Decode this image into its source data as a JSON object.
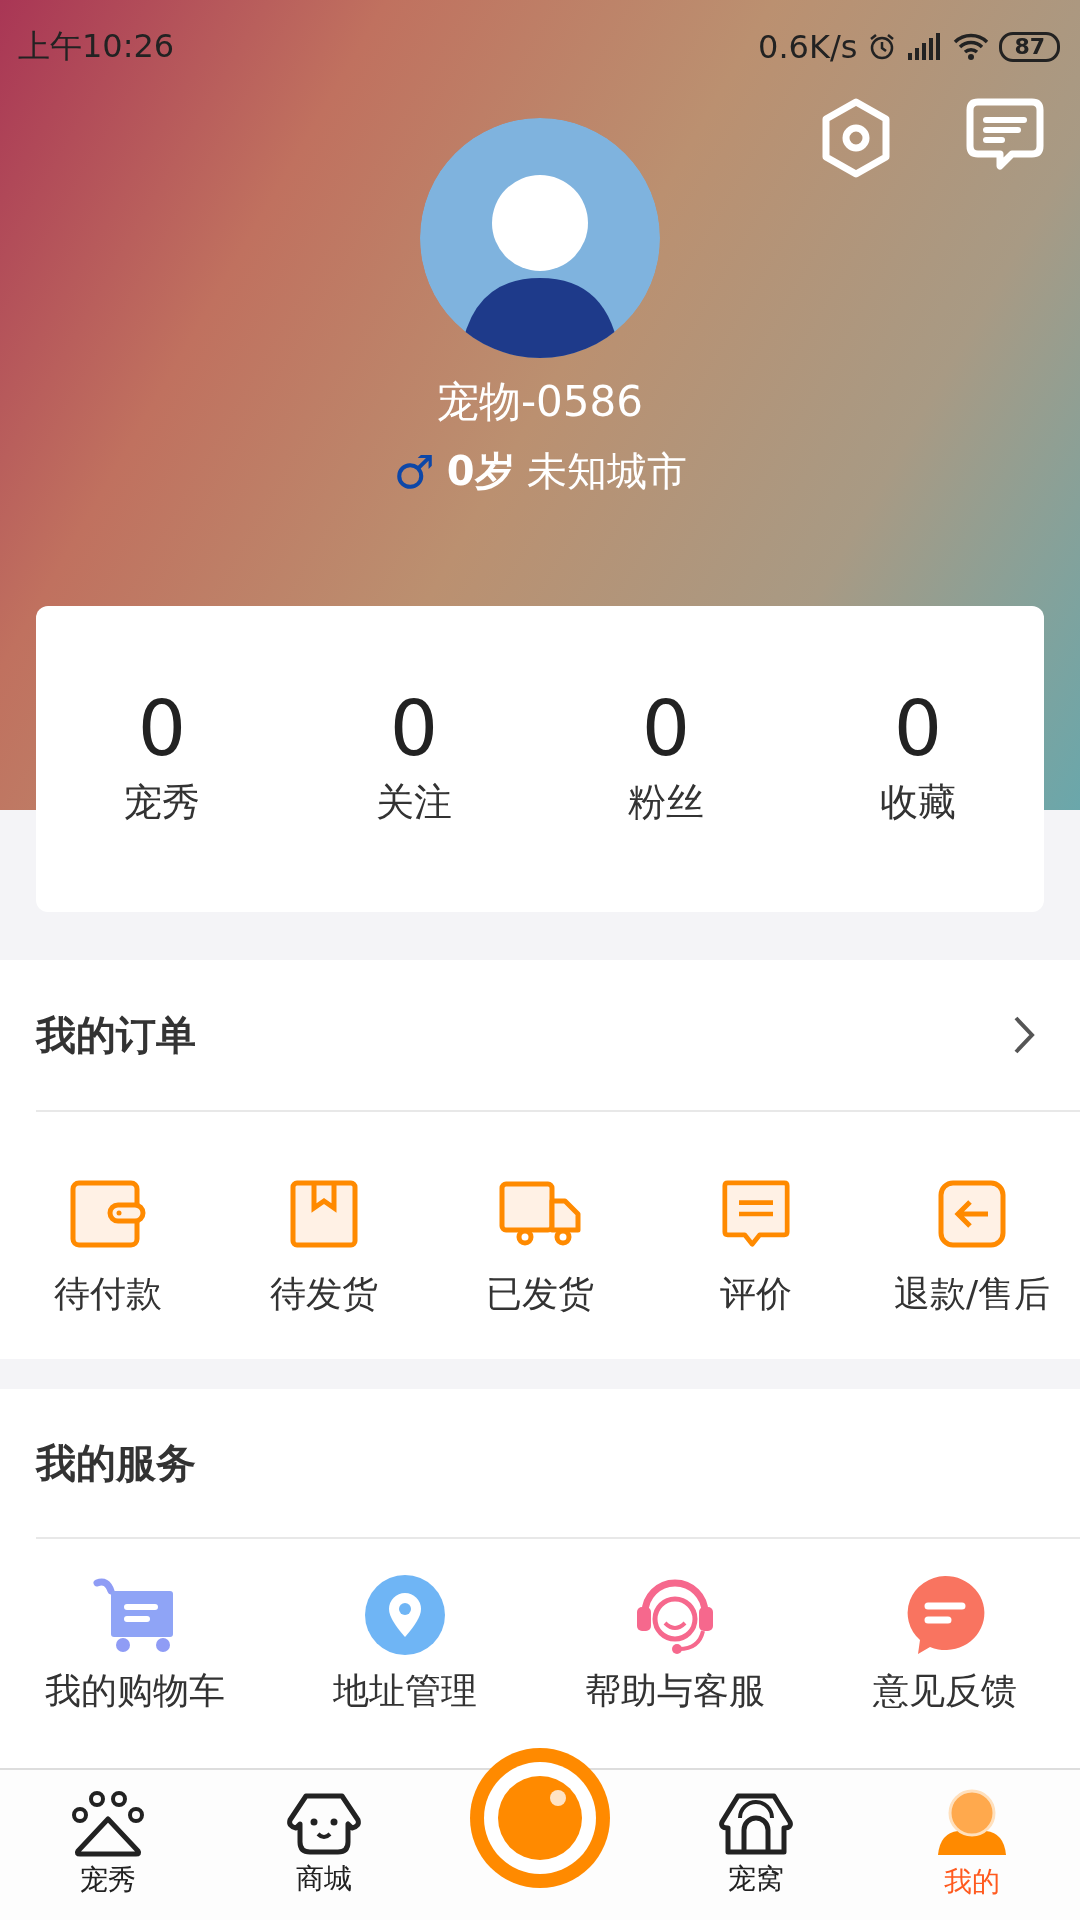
{
  "status_bar": {
    "time": "上午10:26",
    "speed": "0.6K/s",
    "battery": "87"
  },
  "profile": {
    "name": "宠物-0586",
    "gender_symbol": "♂",
    "age": "0岁",
    "city": "未知城市"
  },
  "stats": [
    {
      "value": "0",
      "label": "宠秀"
    },
    {
      "value": "0",
      "label": "关注"
    },
    {
      "value": "0",
      "label": "粉丝"
    },
    {
      "value": "0",
      "label": "收藏"
    }
  ],
  "orders": {
    "title": "我的订单",
    "items": [
      "待付款",
      "待发货",
      "已发货",
      "评价",
      "退款/售后"
    ]
  },
  "services": {
    "title": "我的服务",
    "items": [
      "我的购物车",
      "地址管理",
      "帮助与客服",
      "意见反馈"
    ]
  },
  "tab_bar": [
    {
      "label": "宠秀",
      "selected": false
    },
    {
      "label": "商城",
      "selected": false
    },
    {
      "label": "宠窝",
      "selected": false
    },
    {
      "label": "我的",
      "selected": true
    }
  ]
}
